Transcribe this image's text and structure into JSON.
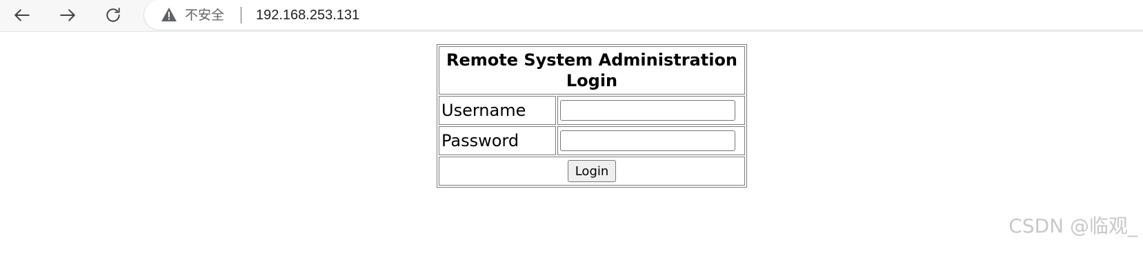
{
  "browser": {
    "security_label": "不安全",
    "url": "192.168.253.131",
    "icons": {
      "back": "arrow-left-icon",
      "forward": "arrow-right-icon",
      "reload": "reload-icon",
      "warning": "warning-triangle-icon"
    }
  },
  "login_form": {
    "title": "Remote System Administration Login",
    "username_label": "Username",
    "username_value": "",
    "password_label": "Password",
    "password_value": "",
    "submit_label": "Login"
  },
  "watermark": "CSDN @临观_"
}
